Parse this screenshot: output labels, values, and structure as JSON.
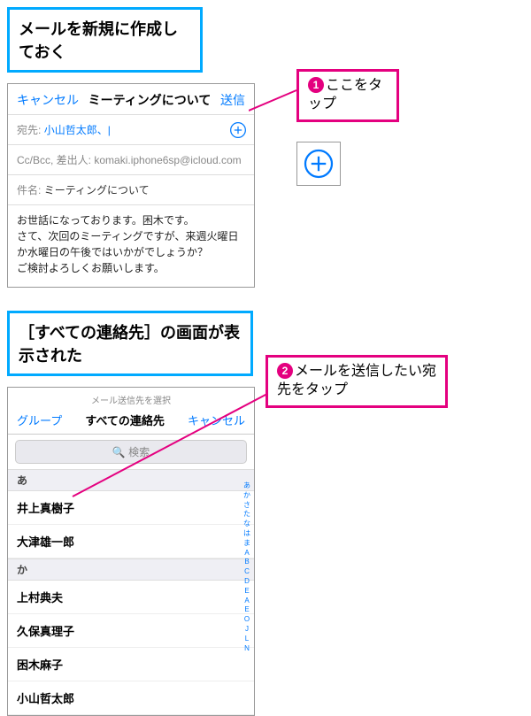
{
  "caption1": "メールを新規に作成しておく",
  "compose": {
    "cancel": "キャンセル",
    "title": "ミーティングについて",
    "send": "送信",
    "to_label": "宛先:",
    "to_value": "小山哲太郎、",
    "cc_label": "Cc/Bcc, 差出人:",
    "cc_value": "komaki.iphone6sp@icloud.com",
    "subject_label": "件名:",
    "subject_value": "ミーティングについて",
    "body": "お世話になっております。困木です。\nさて、次回のミーティングですが、来週火曜日か水曜日の午後ではいかがでしょうか？\nご検討よろしくお願いします。"
  },
  "callout1_num": "1",
  "callout1_text": "ここをタップ",
  "caption2": "［すべての連絡先］の画面が表示された",
  "contacts": {
    "small_title": "メール送信先を選択",
    "groups": "グループ",
    "title": "すべての連絡先",
    "cancel": "キャンセル",
    "search_placeholder": "検索",
    "section_a": "あ",
    "section_ka": "か",
    "rows_a": [
      "井上真樹子",
      "大津雄一郎"
    ],
    "rows_ka": [
      "上村典夫",
      "久保真理子",
      "困木麻子",
      "小山哲太郎"
    ],
    "index": "あ・か・さ・た・な・は・ま・A・B・C・D・E・A・E・O・J・L・N"
  },
  "callout2_num": "2",
  "callout2_text": "メールを送信したい宛先をタップ"
}
